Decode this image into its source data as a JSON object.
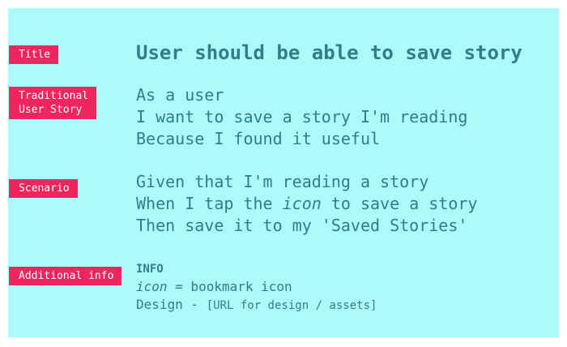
{
  "tags": {
    "title": "Title",
    "story": "Traditional\nUser Story",
    "scenario": "Scenario",
    "info": "Additional info"
  },
  "title": "User should be able to save story",
  "story_lines": [
    "As a user",
    "I want to save a story I'm reading",
    "Because I found it useful"
  ],
  "scenario": {
    "line1": "Given that I'm reading a story",
    "line2_before": "When I tap the ",
    "line2_em": "icon",
    "line2_after": " to save a story",
    "line3": "Then save it to my 'Saved Stories'"
  },
  "info": {
    "heading": "INFO",
    "icon_em": "icon",
    "icon_rest": " = bookmark icon",
    "design_label": "Design - ",
    "design_value": "[URL for design / assets]"
  },
  "colors": {
    "background": "#abfbfc",
    "tag": "#f0245f",
    "text": "#2f7f86"
  }
}
